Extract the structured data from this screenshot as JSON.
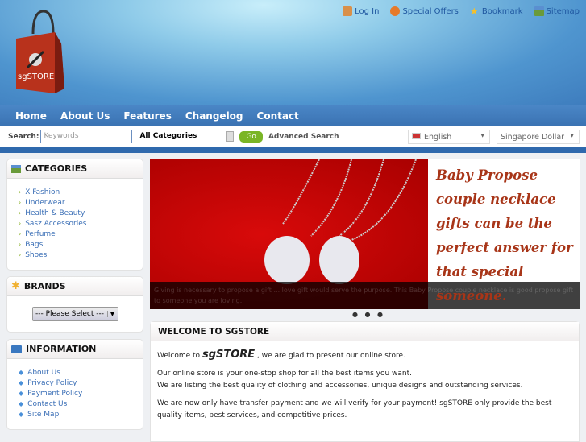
{
  "header": {
    "logo_text": "sgSTORE",
    "top_links": [
      {
        "label": "Log In",
        "icon": "users-icon"
      },
      {
        "label": "Special Offers",
        "icon": "dollar-coin-icon"
      },
      {
        "label": "Bookmark",
        "icon": "star-icon"
      },
      {
        "label": "Sitemap",
        "icon": "sitemap-icon"
      }
    ]
  },
  "nav": [
    "Home",
    "About Us",
    "Features",
    "Changelog",
    "Contact"
  ],
  "search": {
    "label": "Search:",
    "placeholder": "Keywords",
    "category": "All Categories",
    "go": "Go",
    "advanced": "Advanced Search",
    "language": "English",
    "currency": "Singapore Dollar"
  },
  "categories": {
    "title": "CATEGORIES",
    "items": [
      "X Fashion",
      "Underwear",
      "Health & Beauty",
      "Sasz Accessories",
      "Perfume",
      "Bags",
      "Shoes"
    ]
  },
  "brands": {
    "title": "BRANDS",
    "select": "--- Please Select ---"
  },
  "information": {
    "title": "INFORMATION",
    "items": [
      "About Us",
      "Privacy Policy",
      "Payment Policy",
      "Contact Us",
      "Site Map"
    ]
  },
  "slider": {
    "lines": [
      "Baby Propose",
      "couple necklace",
      "gifts can be the",
      "perfect answer for",
      "that special",
      "someone."
    ],
    "caption": "Giving is necessary to propose a gift ... love gift would serve the purpose. This Baby Propose couple necklace is good propose gift to someone you are loving.",
    "dots": "● ● ●"
  },
  "welcome": {
    "title": "WELCOME TO SGSTORE",
    "intro_pre": "Welcome to",
    "brand": "sgSTORE",
    "intro_post": ", we are glad to present our online store.",
    "p2a": "Our online store is your one-stop shop for all the best items you want.",
    "p2b": "We are listing the best quality of clothing and accessories, unique designs and outstanding services.",
    "p3": "We are now only have transfer payment and we will verify for your payment! sgSTORE only provide the best quality items, best services, and competitive prices."
  }
}
